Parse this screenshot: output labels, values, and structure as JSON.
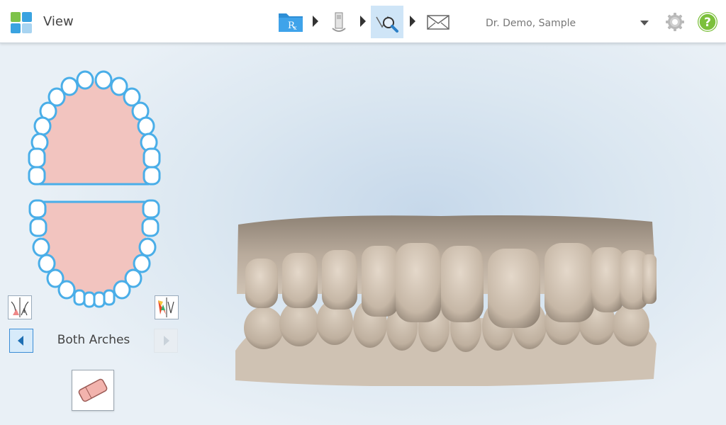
{
  "header": {
    "title": "View",
    "logo_icon": "tile-grid-logo",
    "workflow": [
      {
        "name": "rx-folder-icon",
        "active": false
      },
      {
        "name": "scanner-wand-icon",
        "active": false
      },
      {
        "name": "view-magnifier-icon",
        "active": true
      },
      {
        "name": "send-envelope-icon",
        "active": false
      }
    ],
    "patient": "Dr. Demo, Sample",
    "rx_glyph": "R",
    "help_glyph": "?"
  },
  "sidebar": {
    "arch_label": "Both Arches"
  },
  "colors": {
    "accent": "#3b9be0",
    "tooth_outline": "#4aaee8",
    "palate": "#f2c4bf",
    "help_green": "#7cc03c",
    "scan_model": "#cabcad"
  }
}
